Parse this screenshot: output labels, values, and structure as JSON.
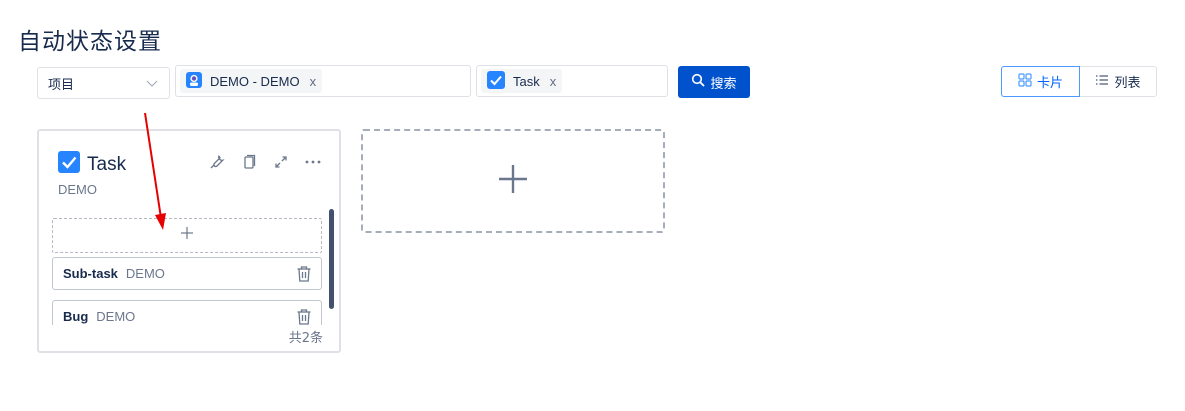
{
  "page": {
    "title": "自动状态设置"
  },
  "filters": {
    "type_select": {
      "value": "项目"
    },
    "project_chips": [
      {
        "label": "DEMO - DEMO"
      }
    ],
    "issuetype_chips": [
      {
        "label": "Task"
      }
    ],
    "chip_remove_glyph": "x",
    "search_label": "搜索"
  },
  "view_toggle": {
    "card_label": "卡片",
    "list_label": "列表",
    "active": "card"
  },
  "scheme_card": {
    "title": "Task",
    "project": "DEMO",
    "add_glyph": "+",
    "items": [
      {
        "name": "Sub-task",
        "project": "DEMO"
      },
      {
        "name": "Bug",
        "project": "DEMO"
      }
    ],
    "total_text": "共2条"
  },
  "add_scheme": {
    "glyph": "+"
  },
  "colors": {
    "primary": "#0052cc",
    "annotation_arrow": "#e60000",
    "border": "#dfe1e6"
  }
}
